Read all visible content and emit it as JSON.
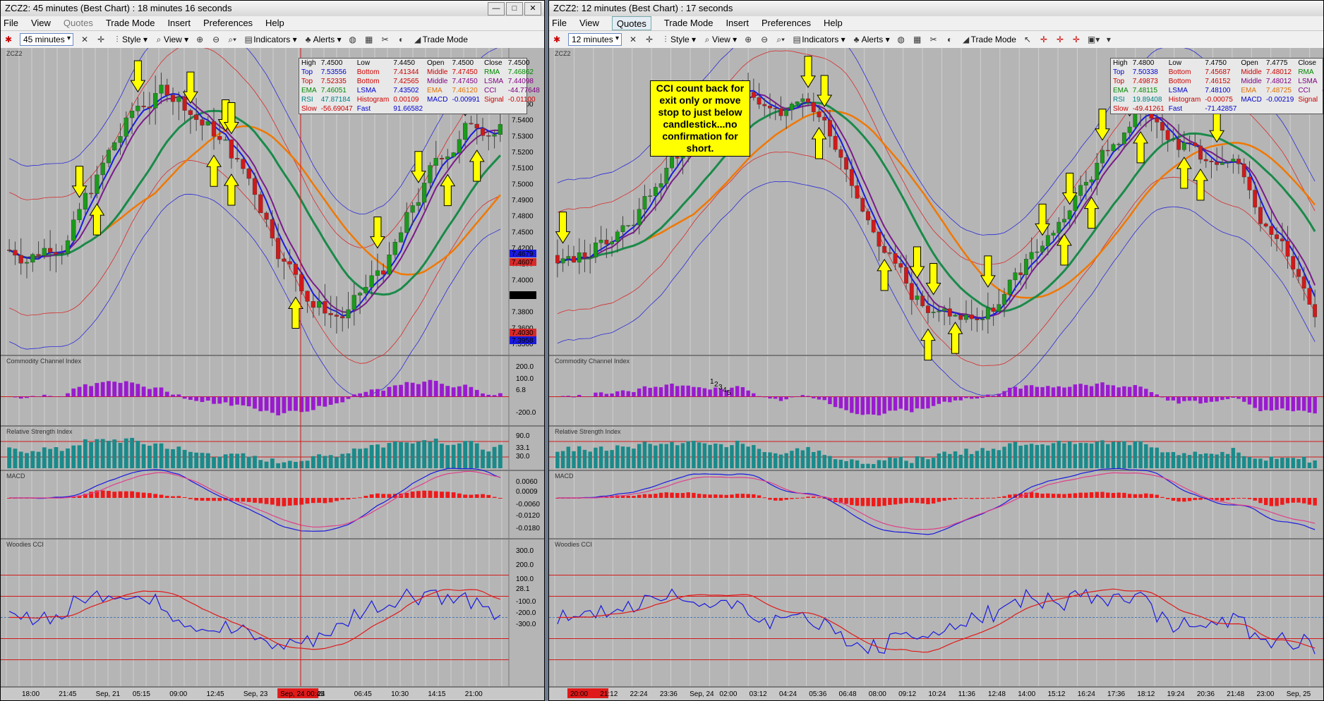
{
  "left": {
    "title": "ZCZ2: 45 minutes (Best Chart) : 18 minutes 16 seconds",
    "menu": [
      "File",
      "View",
      "Quotes",
      "Trade Mode",
      "Insert",
      "Preferences",
      "Help"
    ],
    "interval": "45 minutes",
    "toolbar": {
      "style": "Style",
      "view": "View",
      "indicators": "Indicators",
      "alerts": "Alerts",
      "trade_mode": "Trade Mode"
    },
    "symbol": "ZCZ2",
    "info": {
      "r1": [
        "High",
        "7.4500",
        "Low",
        "7.4450",
        "Open",
        "7.4500",
        "Close",
        "7.4500"
      ],
      "r2": [
        "Top",
        "7.53556",
        "Bottom",
        "7.41344",
        "Middle",
        "7.47450",
        "RMA",
        "7.46862"
      ],
      "r3": [
        "Top",
        "7.52335",
        "Bottom",
        "7.42565",
        "Middle",
        "7.47450",
        "LSMA",
        "7.44098"
      ],
      "r4": [
        "EMA",
        "7.46051",
        "LSMA",
        "7.43502",
        "EMA",
        "7.46120",
        "CCI",
        "-44.77648"
      ],
      "r5": [
        "RSI",
        "47.87184",
        "Histogram",
        "0.00109",
        "MACD",
        "-0.00991",
        "Signal",
        "-0.01100"
      ],
      "r6": [
        "Slow",
        "-56.69047",
        "Fast",
        "91.66582"
      ]
    },
    "price_labels": [
      "7.5500",
      "7.5400",
      "7.5300",
      "7.5200",
      "7.5100",
      "7.5000",
      "7.4900",
      "7.4800",
      "7.4500",
      "7.4200",
      "7.4100",
      "7.4000",
      "7.3900",
      "7.3800",
      "7.3600",
      "7.3500"
    ],
    "price_tags": [
      "7.4679",
      "7.4607",
      "7.4350",
      "7.4030",
      "7.3958"
    ],
    "panes": [
      "Commodity Channel Index",
      "Relative Strength Index",
      "MACD",
      "Woodies CCI"
    ],
    "cci_labels": [
      "200.0",
      "100.0",
      "6.8",
      "-200.0"
    ],
    "rsi_labels": [
      "90.0",
      "33.1",
      "30.0"
    ],
    "macd_labels": [
      "0.0060",
      "0.0009",
      "-0.0060",
      "-0.0120",
      "-0.0180"
    ],
    "wcci_labels": [
      "300.0",
      "200.0",
      "100.0",
      "28.1",
      "-100.0",
      "-200.0",
      "-300.0"
    ],
    "time_labels": [
      "18:00",
      "21:45",
      "Sep, 21",
      "05:15",
      "09:00",
      "12:45",
      "Sep, 23",
      "Sep, 24 00:45",
      "24",
      "06:45",
      "10:30",
      "14:15",
      "21:00"
    ]
  },
  "right": {
    "title": "ZCZ2: 12 minutes (Best Chart) : 17 seconds",
    "menu": [
      "File",
      "View",
      "Quotes",
      "Trade Mode",
      "Insert",
      "Preferences",
      "Help"
    ],
    "interval": "12 minutes",
    "toolbar": {
      "style": "Style",
      "view": "View",
      "indicators": "Indicators",
      "alerts": "Alerts",
      "trade_mode": "Trade Mode"
    },
    "symbol": "ZCZ2",
    "info": {
      "r1": [
        "High",
        "7.4800",
        "Low",
        "7.4750",
        "Open",
        "7.4775",
        "Close",
        ""
      ],
      "r2": [
        "Top",
        "7.50338",
        "Bottom",
        "7.45687",
        "Middle",
        "7.48012",
        "RMA",
        ""
      ],
      "r3": [
        "Top",
        "7.49873",
        "Bottom",
        "7.46152",
        "Middle",
        "7.48012",
        "LSMA",
        ""
      ],
      "r4": [
        "EMA",
        "7.48115",
        "LSMA",
        "7.48100",
        "EMA",
        "7.48725",
        "CCI",
        "-87.0"
      ],
      "r5": [
        "RSI",
        "19.89408",
        "Histogram",
        "-0.00075",
        "MACD",
        "-0.00219",
        "Signal",
        ""
      ],
      "r6": [
        "Slow",
        "-49.41261",
        "Fast",
        "-71.42857"
      ]
    },
    "note": "CCI count back for exit only or move stop to just below candlestick...no confirmation for short.",
    "count_labels": [
      "1",
      "2",
      "3",
      "4",
      "5"
    ],
    "panes": [
      "Commodity Channel Index",
      "Relative Strength Index",
      "MACD",
      "Woodies CCI"
    ],
    "time_labels": [
      "20:00",
      "21:12",
      "22:24",
      "23:36",
      "Sep, 24",
      "02:00",
      "03:12",
      "04:24",
      "05:36",
      "06:48",
      "08:00",
      "09:12",
      "10:24",
      "11:36",
      "12:48",
      "14:00",
      "15:12",
      "16:24",
      "17:36",
      "18:12",
      "19:24",
      "20:36",
      "21:48",
      "23:00",
      "Sep, 25"
    ]
  }
}
